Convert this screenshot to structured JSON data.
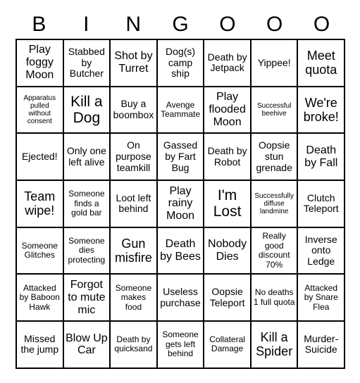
{
  "header": {
    "letters": [
      "B",
      "I",
      "N",
      "G",
      "O",
      "O",
      "O"
    ]
  },
  "grid": {
    "columns": 7,
    "rows": 7,
    "cells": [
      [
        {
          "text": "Play foggy Moon",
          "size": "fs-lg"
        },
        {
          "text": "Stabbed by Butcher",
          "size": "fs-md"
        },
        {
          "text": "Shot by Turret",
          "size": "fs-lg"
        },
        {
          "text": "Dog(s) camp ship",
          "size": "fs-md"
        },
        {
          "text": "Death by Jetpack",
          "size": "fs-md"
        },
        {
          "text": "Yippee!",
          "size": "fs-md"
        },
        {
          "text": "Meet quota",
          "size": "fs-xl"
        }
      ],
      [
        {
          "text": "Apparatus pulled without consent",
          "size": "fs-xs"
        },
        {
          "text": "Kill a Dog",
          "size": "fs-xxl"
        },
        {
          "text": "Buy a boombox",
          "size": "fs-md"
        },
        {
          "text": "Avenge Teammate",
          "size": "fs-sm"
        },
        {
          "text": "Play flooded Moon",
          "size": "fs-lg"
        },
        {
          "text": "Successful beehive",
          "size": "fs-xs"
        },
        {
          "text": "We're broke!",
          "size": "fs-xl"
        }
      ],
      [
        {
          "text": "Ejected!",
          "size": "fs-md"
        },
        {
          "text": "Only one left alive",
          "size": "fs-md"
        },
        {
          "text": "On purpose teamkill",
          "size": "fs-md"
        },
        {
          "text": "Gassed by Fart Bug",
          "size": "fs-md"
        },
        {
          "text": "Death by Robot",
          "size": "fs-md"
        },
        {
          "text": "Oopsie stun grenade",
          "size": "fs-md"
        },
        {
          "text": "Death by Fall",
          "size": "fs-lg"
        }
      ],
      [
        {
          "text": "Team wipe!",
          "size": "fs-xl"
        },
        {
          "text": "Someone finds a gold bar",
          "size": "fs-sm"
        },
        {
          "text": "Loot left behind",
          "size": "fs-md"
        },
        {
          "text": "Play rainy Moon",
          "size": "fs-lg"
        },
        {
          "text": "I'm Lost",
          "size": "fs-xxl"
        },
        {
          "text": "Successfully diffuse landmine",
          "size": "fs-xs"
        },
        {
          "text": "Clutch Teleport",
          "size": "fs-md"
        }
      ],
      [
        {
          "text": "Someone Glitches",
          "size": "fs-sm"
        },
        {
          "text": "Someone dies protecting",
          "size": "fs-sm"
        },
        {
          "text": "Gun misfire",
          "size": "fs-xl"
        },
        {
          "text": "Death by Bees",
          "size": "fs-lg"
        },
        {
          "text": "Nobody Dies",
          "size": "fs-lg"
        },
        {
          "text": "Really good discount 70%",
          "size": "fs-sm"
        },
        {
          "text": "Inverse onto Ledge",
          "size": "fs-md"
        }
      ],
      [
        {
          "text": "Attacked by Baboon Hawk",
          "size": "fs-sm"
        },
        {
          "text": "Forgot to mute mic",
          "size": "fs-lg"
        },
        {
          "text": "Someone makes food",
          "size": "fs-sm"
        },
        {
          "text": "Useless purchase",
          "size": "fs-md"
        },
        {
          "text": "Oopsie Teleport",
          "size": "fs-md"
        },
        {
          "text": "No deaths 1 full quota",
          "size": "fs-sm"
        },
        {
          "text": "Attacked by Snare Flea",
          "size": "fs-sm"
        }
      ],
      [
        {
          "text": "Missed the jump",
          "size": "fs-md"
        },
        {
          "text": "Blow Up Car",
          "size": "fs-lg"
        },
        {
          "text": "Death by quicksand",
          "size": "fs-sm"
        },
        {
          "text": "Someone gets left behind",
          "size": "fs-sm"
        },
        {
          "text": "Collateral Damage",
          "size": "fs-sm"
        },
        {
          "text": "Kill a Spider",
          "size": "fs-xl"
        },
        {
          "text": "Murder-Suicide",
          "size": "fs-md"
        }
      ]
    ]
  }
}
